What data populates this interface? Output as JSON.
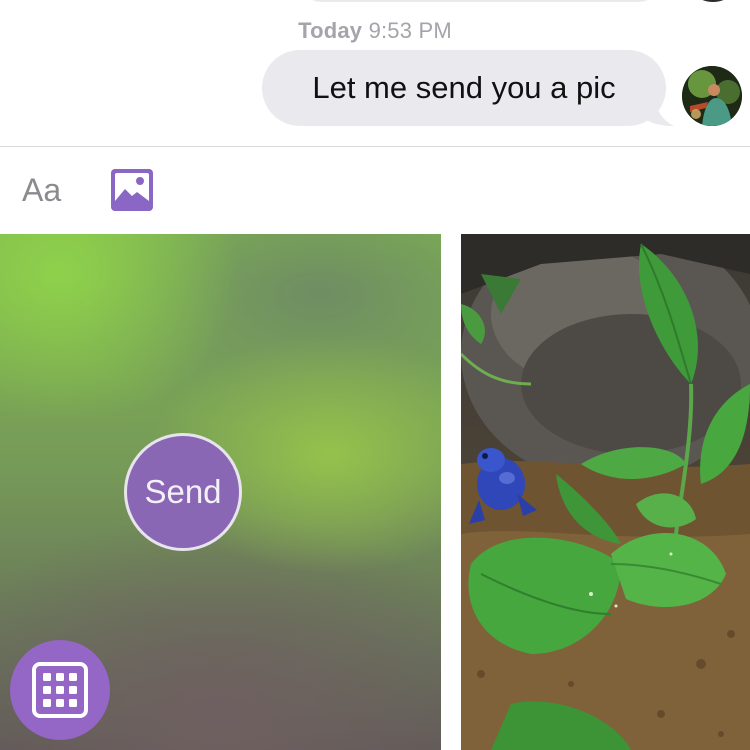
{
  "conversation": {
    "timestamp": {
      "day": "Today",
      "time": "9:53 PM"
    },
    "message": {
      "text": "Let me send you a pic"
    },
    "avatar_icon": "profile-photo-avatar"
  },
  "composer": {
    "text_toggle_label": "Aa",
    "photo_tab_icon": "photo-icon",
    "accent_color": "#8a67b4"
  },
  "media_picker": {
    "camera": {
      "send_label": "Send"
    },
    "gallery_icon": "grid-icon",
    "photo_subject": "blue-frog-plant-photo"
  }
}
